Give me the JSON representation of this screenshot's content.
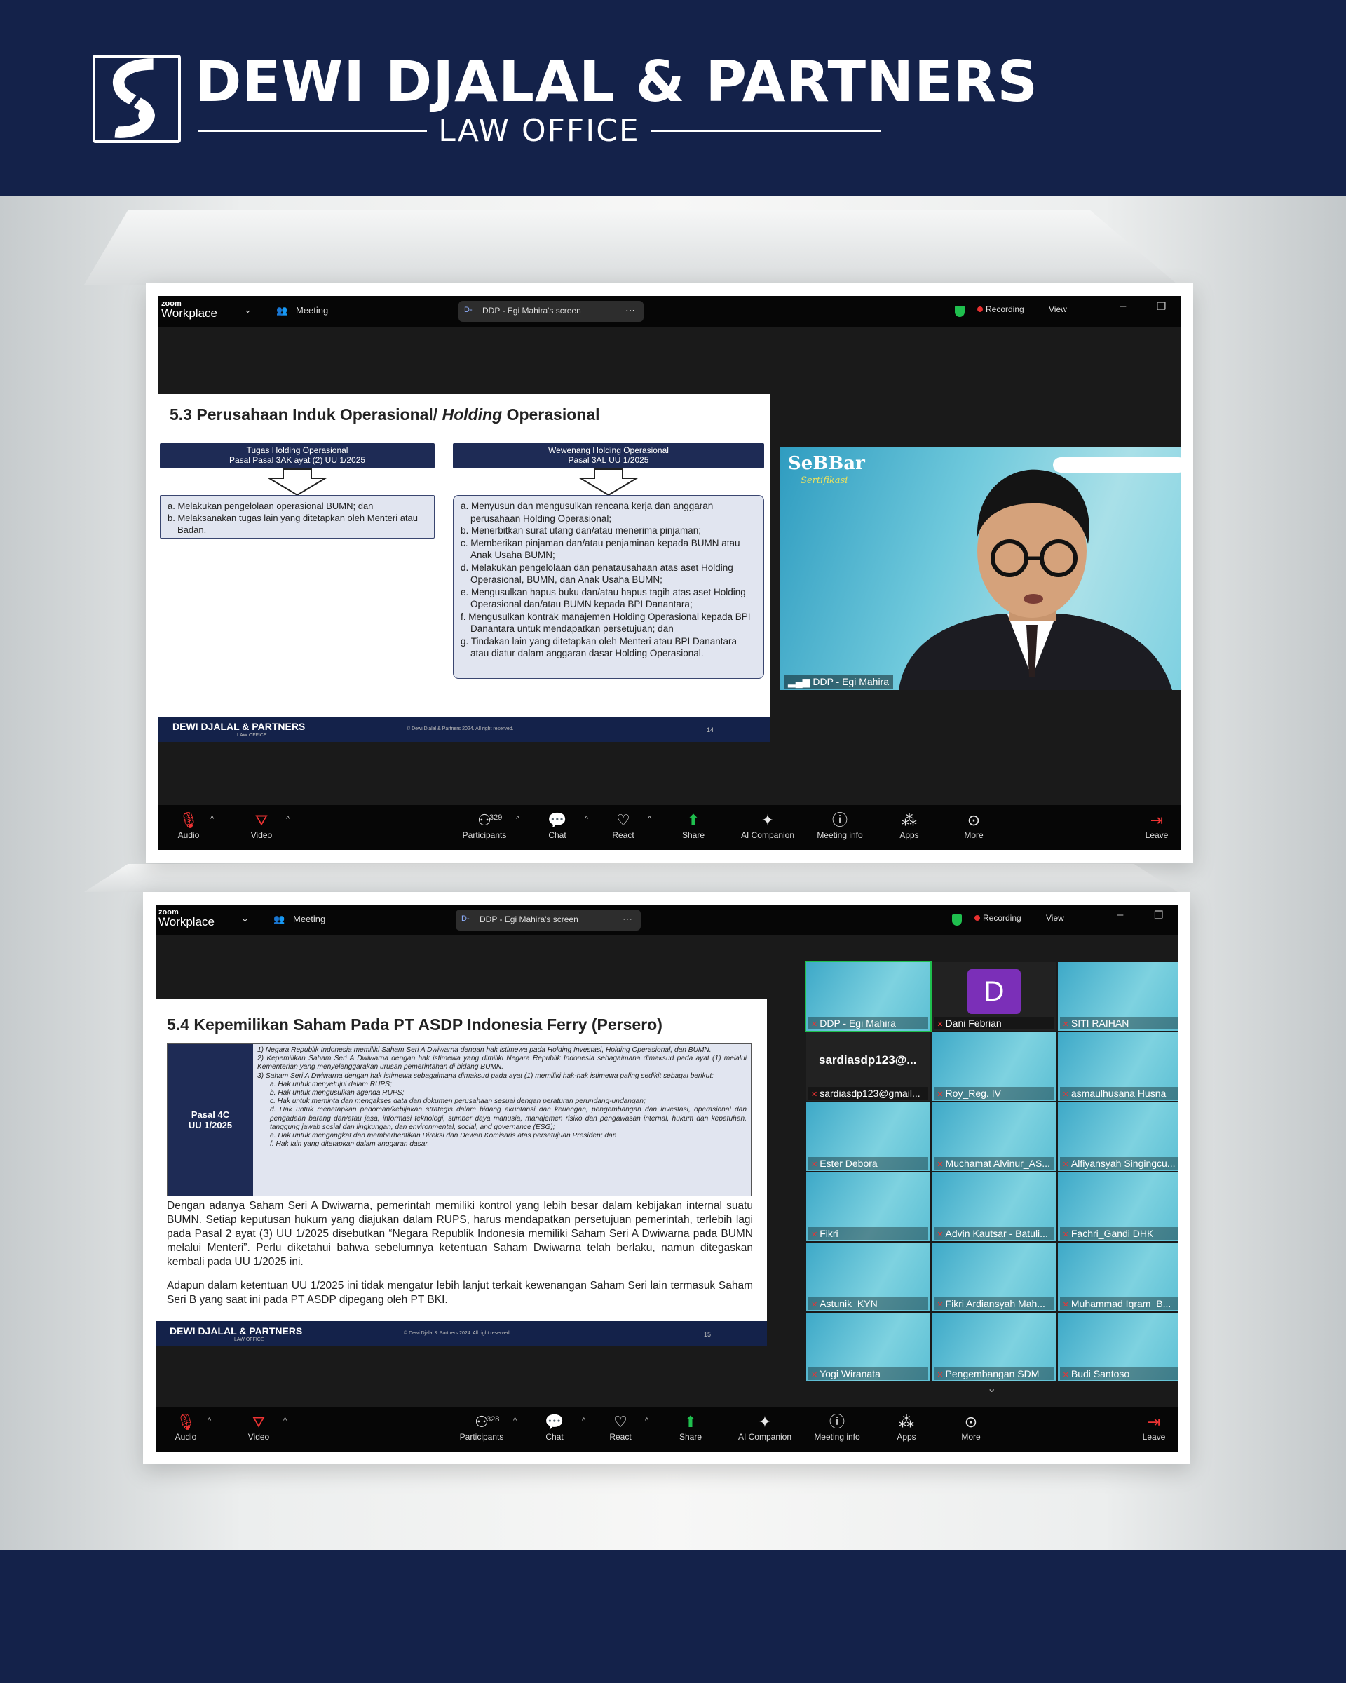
{
  "brand": {
    "name": "DEWI DJALAL & PARTNERS",
    "subtitle": "LAW OFFICE"
  },
  "screenshots": [
    {
      "app": {
        "logo_small": "zoom",
        "logo_big": "Workplace",
        "meeting_label": "Meeting"
      },
      "share_title": "DDP - Egi Mahira's screen",
      "share_badge": "D-",
      "recording_label": "Recording",
      "view_label": "View",
      "slide": {
        "title_part1": "5.3 Perusahaan Induk Operasional/ ",
        "title_italic": "Holding",
        "title_part2": " Operasional",
        "left_head_1": "Tugas Holding Operasional",
        "left_head_2": "Pasal Pasal 3AK ayat (2) UU 1/2025",
        "left_items": [
          "a. Melakukan pengelolaan operasional BUMN; dan",
          "b. Melaksanakan tugas lain yang ditetapkan oleh Menteri atau Badan."
        ],
        "right_head_1": "Wewenang Holding Operasional",
        "right_head_2": "Pasal 3AL UU 1/2025",
        "right_items": [
          "a. Menyusun dan mengusulkan rencana kerja dan anggaran perusahaan Holding Operasional;",
          "b. Menerbitkan surat utang dan/atau menerima pinjaman;",
          "c. Memberikan pinjaman dan/atau penjaminan kepada BUMN atau Anak Usaha BUMN;",
          "d. Melakukan pengelolaan dan penatausahaan atas aset Holding Operasional, BUMN, dan Anak Usaha BUMN;",
          "e. Mengusulkan hapus buku dan/atau hapus tagih atas aset Holding Operasional dan/atau BUMN kepada BPI Danantara;",
          "f. Mengusulkan kontrak manajemen Holding Operasional kepada BPI Danantara untuk mendapatkan persetujuan; dan",
          "g. Tindakan lain yang ditetapkan oleh Menteri atau BPI Danantara atau diatur dalam anggaran dasar Holding Operasional."
        ],
        "footer_brand": "DEWI DJALAL & PARTNERS",
        "footer_sub": "LAW OFFICE",
        "copyright": "© Dewi Djalal & Partners 2024. All right reserved.",
        "page": "14"
      },
      "speaker": {
        "name": "DDP - Egi Mahira",
        "banner": "SeBBar",
        "banner_sub": "Sertifikasi"
      },
      "controls": {
        "audio": "Audio",
        "video": "Video",
        "participants": "Participants",
        "participants_count": "329",
        "chat": "Chat",
        "react": "React",
        "share": "Share",
        "ai": "AI Companion",
        "info": "Meeting info",
        "apps": "Apps",
        "more": "More",
        "leave": "Leave"
      }
    },
    {
      "app": {
        "logo_small": "zoom",
        "logo_big": "Workplace",
        "meeting_label": "Meeting"
      },
      "share_title": "DDP - Egi Mahira's screen",
      "share_badge": "D-",
      "recording_label": "Recording",
      "view_label": "View",
      "slide": {
        "title": "5.4 Kepemilikan Saham Pada PT ASDP Indonesia Ferry (Persero)",
        "pasal_label_1": "Pasal 4C",
        "pasal_label_2": "UU 1/2025",
        "pasal_items": [
          "1)  Negara Republik Indonesia memiliki Saham Seri A Dwiwarna dengan hak istimewa pada Holding Investasi, Holding Operasional, dan BUMN.",
          "2)  Kepemilikan Saham Seri A Dwiwarna dengan hak istimewa yang dimiliki Negara Republik Indonesia sebagaimana dimaksud pada ayat (1) melalui Kementerian yang menyelenggarakan urusan pemerintahan di bidang BUMN.",
          "3)  Saham Seri A Dwiwarna dengan hak istimewa sebagaimana dimaksud pada ayat (1) memiliki hak-hak istimewa paling sedikit sebagai berikut:",
          "a.  Hak untuk menyetujui dalam RUPS;",
          "b.  Hak untuk mengusulkan agenda RUPS;",
          "c.  Hak untuk meminta dan mengakses data dan dokumen perusahaan sesuai dengan peraturan perundang-undangan;",
          "d.  Hak untuk menetapkan pedoman/kebijakan strategis dalam bidang akuntansi dan keuangan, pengembangan dan investasi, operasional dan pengadaan barang dan/atau jasa, informasi teknologi, sumber daya manusia, manajemen risiko dan pengawasan internal, hukum dan kepatuhan, tanggung jawab sosial dan lingkungan, dan environmental, social, and governance (ESG);",
          "e.  Hak untuk mengangkat dan memberhentikan Direksi dan Dewan Komisaris atas persetujuan Presiden; dan",
          "f.  Hak lain yang ditetapkan dalam anggaran dasar."
        ],
        "para1": "Dengan adanya Saham Seri A Dwiwarna, pemerintah memiliki kontrol yang lebih besar dalam kebijakan internal suatu BUMN. Setiap keputusan hukum yang diajukan dalam RUPS, harus mendapatkan persetujuan pemerintah, terlebih lagi pada Pasal 2 ayat (3) UU 1/2025 disebutkan “Negara Republik Indonesia memiliki Saham Seri A Dwiwarna pada BUMN melalui Menteri”. Perlu diketahui bahwa sebelumnya ketentuan Saham Dwiwarna telah berlaku, namun ditegaskan kembali pada UU 1/2025 ini.",
        "para2": "Adapun dalam ketentuan UU 1/2025 ini tidak mengatur lebih lanjut terkait kewenangan Saham Seri lain termasuk Saham Seri B yang saat ini pada PT ASDP dipegang oleh PT BKI.",
        "footer_brand": "DEWI DJALAL & PARTNERS",
        "footer_sub": "LAW OFFICE",
        "copyright": "© Dewi Djalal & Partners 2024. All right reserved.",
        "page": "15"
      },
      "gallery": [
        {
          "name": "DDP - Egi Mahira",
          "kind": "video"
        },
        {
          "name": "Dani Febrian",
          "kind": "avatar",
          "initial": "D",
          "avatar_color": "#7b2fb8"
        },
        {
          "name": "SITI RAIHAN",
          "kind": "video"
        },
        {
          "name": "sardiasdp123@gmail...",
          "kind": "text",
          "big": "sardiasdp123@..."
        },
        {
          "name": "Roy_Reg. IV",
          "kind": "video"
        },
        {
          "name": "asmaulhusana Husna",
          "kind": "video"
        },
        {
          "name": "Ester Debora",
          "kind": "video"
        },
        {
          "name": "Muchamat Alvinur_AS...",
          "kind": "video"
        },
        {
          "name": "Alfiyansyah Singingcu...",
          "kind": "video"
        },
        {
          "name": "Fikri",
          "kind": "video"
        },
        {
          "name": "Advin Kautsar - Batuli...",
          "kind": "video"
        },
        {
          "name": "Fachri_Gandi DHK",
          "kind": "video"
        },
        {
          "name": "Astunik_KYN",
          "kind": "video"
        },
        {
          "name": "Fikri Ardiansyah Mah...",
          "kind": "video"
        },
        {
          "name": "Muhammad Iqram_B...",
          "kind": "video"
        },
        {
          "name": "Yogi Wiranata",
          "kind": "video"
        },
        {
          "name": "Pengembangan SDM",
          "kind": "video"
        },
        {
          "name": "Budi Santoso",
          "kind": "video"
        }
      ],
      "controls": {
        "audio": "Audio",
        "video": "Video",
        "participants": "Participants",
        "participants_count": "328",
        "chat": "Chat",
        "react": "React",
        "share": "Share",
        "ai": "AI Companion",
        "info": "Meeting info",
        "apps": "Apps",
        "more": "More",
        "leave": "Leave"
      }
    }
  ],
  "colors": {
    "navy": "#14224a",
    "zoom_bg": "#1a1a1a",
    "green": "#1fbf4e",
    "recording": "#e83030"
  },
  "icons": [
    "firm-logo-icon",
    "microphone-muted-icon",
    "video-off-icon",
    "participants-icon",
    "chat-icon",
    "react-heart-icon",
    "share-screen-icon",
    "ai-sparkle-icon",
    "info-icon",
    "apps-icon",
    "more-icon",
    "leave-icon",
    "shield-icon",
    "signal-icon"
  ]
}
